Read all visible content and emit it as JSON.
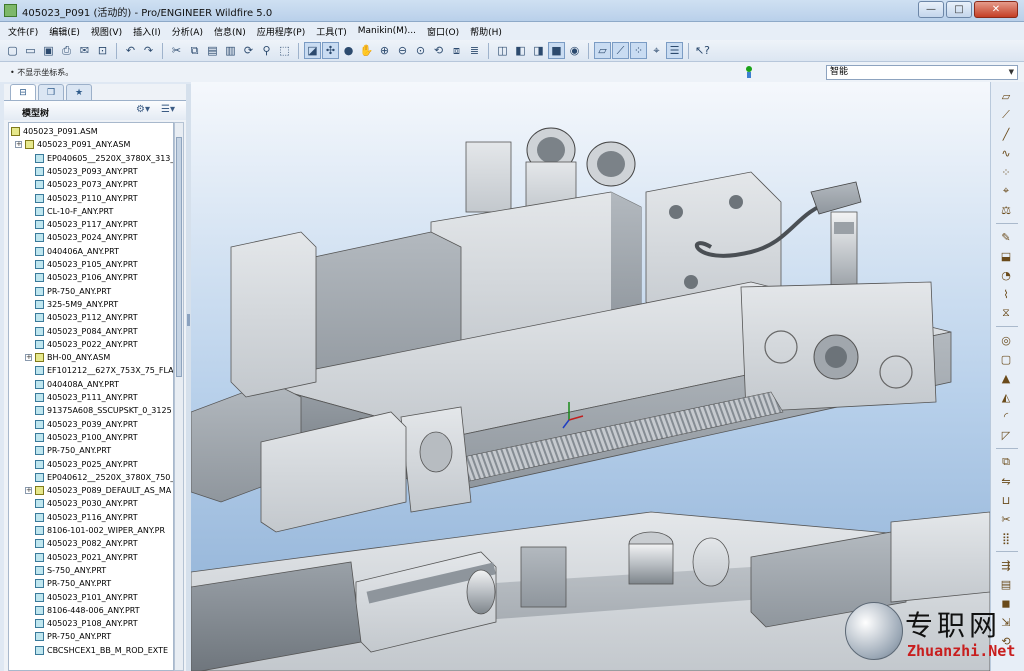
{
  "window": {
    "title": "405023_P091 (活动的) - Pro/ENGINEER Wildfire 5.0",
    "buttons": {
      "minimize": "—",
      "maximize": "□",
      "close": "✕"
    }
  },
  "menu": [
    "文件(F)",
    "编辑(E)",
    "视图(V)",
    "插入(I)",
    "分析(A)",
    "信息(N)",
    "应用程序(P)",
    "工具(T)",
    "Manikin(M)...",
    "窗口(O)",
    "帮助(H)"
  ],
  "toolbar": {
    "groups": [
      [
        "new-icon",
        "open-icon",
        "save-icon",
        "print-icon",
        "email-icon",
        "send-icon"
      ],
      [
        "undo-icon",
        "redo-icon"
      ],
      [
        "cut-icon",
        "copy-icon",
        "paste-icon",
        "paste-special-icon",
        "regenerate-icon",
        "find-icon",
        "select-box-icon"
      ],
      [
        "repaint-icon",
        "spin-center-icon",
        "orient-icon",
        "pan-icon",
        "zoom-in-icon",
        "zoom-out-icon",
        "refit-icon",
        "reorient-icon",
        "saved-views-icon",
        "layers-icon"
      ],
      [
        "wireframe-icon",
        "hidden-line-icon",
        "no-hidden-icon",
        "shading-icon",
        "appearance-icon"
      ],
      [
        "datum-planes-icon",
        "datum-axes-icon",
        "datum-points-icon",
        "coordinate-systems-icon",
        "annotations-icon"
      ],
      [
        "context-help-icon"
      ]
    ]
  },
  "status": {
    "message": "• 不显示坐标系。",
    "filter_value": "智能"
  },
  "model_tree": {
    "header": "模型树",
    "items": [
      {
        "label": "405023_P091.ASM",
        "type": "asm",
        "level": 0
      },
      {
        "label": "405023_P091_ANY.ASM",
        "type": "asm",
        "level": 1,
        "expandable": true
      },
      {
        "label": "EP040605__2520X_3780X_313_",
        "type": "prt",
        "level": 2
      },
      {
        "label": "405023_P093_ANY.PRT",
        "type": "prt",
        "level": 2
      },
      {
        "label": "405023_P073_ANY.PRT",
        "type": "prt",
        "level": 2
      },
      {
        "label": "405023_P110_ANY.PRT",
        "type": "prt",
        "level": 2
      },
      {
        "label": "CL-10-F_ANY.PRT",
        "type": "prt",
        "level": 2
      },
      {
        "label": "405023_P117_ANY.PRT",
        "type": "prt",
        "level": 2
      },
      {
        "label": "405023_P024_ANY.PRT",
        "type": "prt",
        "level": 2
      },
      {
        "label": "040406A_ANY.PRT",
        "type": "prt",
        "level": 2
      },
      {
        "label": "405023_P105_ANY.PRT",
        "type": "prt",
        "level": 2
      },
      {
        "label": "405023_P106_ANY.PRT",
        "type": "prt",
        "level": 2
      },
      {
        "label": "PR-750_ANY.PRT",
        "type": "prt",
        "level": 2
      },
      {
        "label": "325-5M9_ANY.PRT",
        "type": "prt",
        "level": 2
      },
      {
        "label": "405023_P112_ANY.PRT",
        "type": "prt",
        "level": 2
      },
      {
        "label": "405023_P084_ANY.PRT",
        "type": "prt",
        "level": 2
      },
      {
        "label": "405023_P022_ANY.PRT",
        "type": "prt",
        "level": 2
      },
      {
        "label": "BH-00_ANY.ASM",
        "type": "asm",
        "level": 2,
        "expandable": true
      },
      {
        "label": "EF101212__627X_753X_75_FLA",
        "type": "prt",
        "level": 2
      },
      {
        "label": "040408A_ANY.PRT",
        "type": "prt",
        "level": 2
      },
      {
        "label": "405023_P111_ANY.PRT",
        "type": "prt",
        "level": 2
      },
      {
        "label": "91375A608_SSCUPSKT_0_3125",
        "type": "prt",
        "level": 2
      },
      {
        "label": "405023_P039_ANY.PRT",
        "type": "prt",
        "level": 2
      },
      {
        "label": "405023_P100_ANY.PRT",
        "type": "prt",
        "level": 2
      },
      {
        "label": "PR-750_ANY.PRT",
        "type": "prt",
        "level": 2
      },
      {
        "label": "405023_P025_ANY.PRT",
        "type": "prt",
        "level": 2
      },
      {
        "label": "EP040612__2520X_3780X_750_",
        "type": "prt",
        "level": 2
      },
      {
        "label": "405023_P089_DEFAULT_AS_MA",
        "type": "asm",
        "level": 2,
        "expandable": true
      },
      {
        "label": "405023_P030_ANY.PRT",
        "type": "prt",
        "level": 2
      },
      {
        "label": "405023_P116_ANY.PRT",
        "type": "prt",
        "level": 2
      },
      {
        "label": "8106-101-002_WIPER_ANY.PR",
        "type": "prt",
        "level": 2
      },
      {
        "label": "405023_P082_ANY.PRT",
        "type": "prt",
        "level": 2
      },
      {
        "label": "405023_P021_ANY.PRT",
        "type": "prt",
        "level": 2
      },
      {
        "label": "S-750_ANY.PRT",
        "type": "prt",
        "level": 2
      },
      {
        "label": "PR-750_ANY.PRT",
        "type": "prt",
        "level": 2
      },
      {
        "label": "405023_P101_ANY.PRT",
        "type": "prt",
        "level": 2
      },
      {
        "label": "8106-448-006_ANY.PRT",
        "type": "prt",
        "level": 2
      },
      {
        "label": "405023_P108_ANY.PRT",
        "type": "prt",
        "level": 2
      },
      {
        "label": "PR-750_ANY.PRT",
        "type": "prt",
        "level": 2
      },
      {
        "label": "CBCSHCEX1_BB_M_ROD_EXTE",
        "type": "prt",
        "level": 2
      }
    ]
  },
  "right_toolbar": [
    "datum-plane-icon",
    "sketch-icon",
    "datum-axis-icon",
    "datum-curve-icon",
    "datum-point-icon",
    "csys-icon",
    "analysis-icon",
    "sketch-tool-icon",
    "extrude-icon",
    "revolve-icon",
    "sweep-icon",
    "blend-icon",
    "hole-icon",
    "shell-icon",
    "rib-icon",
    "draft-icon",
    "round-icon",
    "chamfer-icon",
    "copy-icon",
    "mirror-icon",
    "merge-icon",
    "trim-icon",
    "pattern-icon",
    "offset-icon",
    "thicken-icon",
    "solidify-icon",
    "project-icon",
    "wrap-icon"
  ],
  "watermark": {
    "cn": "专职网",
    "en": "Zhuanzhi.Net"
  },
  "colors": {
    "viewport_top": "#f5f8fc",
    "viewport_bottom": "#89acd3",
    "model_grey": "#c4c8cc"
  }
}
